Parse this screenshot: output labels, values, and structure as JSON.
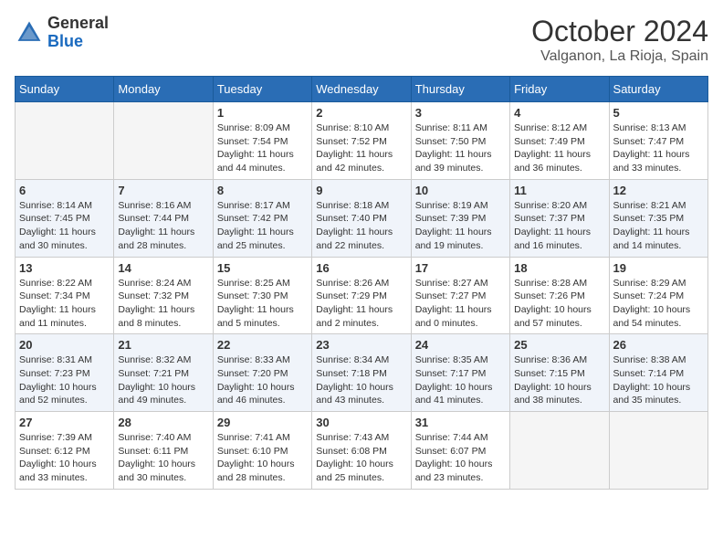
{
  "header": {
    "logo_general": "General",
    "logo_blue": "Blue",
    "month_title": "October 2024",
    "location": "Valganon, La Rioja, Spain"
  },
  "days_of_week": [
    "Sunday",
    "Monday",
    "Tuesday",
    "Wednesday",
    "Thursday",
    "Friday",
    "Saturday"
  ],
  "weeks": [
    [
      {
        "day": "",
        "sunrise": "",
        "sunset": "",
        "daylight": ""
      },
      {
        "day": "",
        "sunrise": "",
        "sunset": "",
        "daylight": ""
      },
      {
        "day": "1",
        "sunrise": "Sunrise: 8:09 AM",
        "sunset": "Sunset: 7:54 PM",
        "daylight": "Daylight: 11 hours and 44 minutes."
      },
      {
        "day": "2",
        "sunrise": "Sunrise: 8:10 AM",
        "sunset": "Sunset: 7:52 PM",
        "daylight": "Daylight: 11 hours and 42 minutes."
      },
      {
        "day": "3",
        "sunrise": "Sunrise: 8:11 AM",
        "sunset": "Sunset: 7:50 PM",
        "daylight": "Daylight: 11 hours and 39 minutes."
      },
      {
        "day": "4",
        "sunrise": "Sunrise: 8:12 AM",
        "sunset": "Sunset: 7:49 PM",
        "daylight": "Daylight: 11 hours and 36 minutes."
      },
      {
        "day": "5",
        "sunrise": "Sunrise: 8:13 AM",
        "sunset": "Sunset: 7:47 PM",
        "daylight": "Daylight: 11 hours and 33 minutes."
      }
    ],
    [
      {
        "day": "6",
        "sunrise": "Sunrise: 8:14 AM",
        "sunset": "Sunset: 7:45 PM",
        "daylight": "Daylight: 11 hours and 30 minutes."
      },
      {
        "day": "7",
        "sunrise": "Sunrise: 8:16 AM",
        "sunset": "Sunset: 7:44 PM",
        "daylight": "Daylight: 11 hours and 28 minutes."
      },
      {
        "day": "8",
        "sunrise": "Sunrise: 8:17 AM",
        "sunset": "Sunset: 7:42 PM",
        "daylight": "Daylight: 11 hours and 25 minutes."
      },
      {
        "day": "9",
        "sunrise": "Sunrise: 8:18 AM",
        "sunset": "Sunset: 7:40 PM",
        "daylight": "Daylight: 11 hours and 22 minutes."
      },
      {
        "day": "10",
        "sunrise": "Sunrise: 8:19 AM",
        "sunset": "Sunset: 7:39 PM",
        "daylight": "Daylight: 11 hours and 19 minutes."
      },
      {
        "day": "11",
        "sunrise": "Sunrise: 8:20 AM",
        "sunset": "Sunset: 7:37 PM",
        "daylight": "Daylight: 11 hours and 16 minutes."
      },
      {
        "day": "12",
        "sunrise": "Sunrise: 8:21 AM",
        "sunset": "Sunset: 7:35 PM",
        "daylight": "Daylight: 11 hours and 14 minutes."
      }
    ],
    [
      {
        "day": "13",
        "sunrise": "Sunrise: 8:22 AM",
        "sunset": "Sunset: 7:34 PM",
        "daylight": "Daylight: 11 hours and 11 minutes."
      },
      {
        "day": "14",
        "sunrise": "Sunrise: 8:24 AM",
        "sunset": "Sunset: 7:32 PM",
        "daylight": "Daylight: 11 hours and 8 minutes."
      },
      {
        "day": "15",
        "sunrise": "Sunrise: 8:25 AM",
        "sunset": "Sunset: 7:30 PM",
        "daylight": "Daylight: 11 hours and 5 minutes."
      },
      {
        "day": "16",
        "sunrise": "Sunrise: 8:26 AM",
        "sunset": "Sunset: 7:29 PM",
        "daylight": "Daylight: 11 hours and 2 minutes."
      },
      {
        "day": "17",
        "sunrise": "Sunrise: 8:27 AM",
        "sunset": "Sunset: 7:27 PM",
        "daylight": "Daylight: 11 hours and 0 minutes."
      },
      {
        "day": "18",
        "sunrise": "Sunrise: 8:28 AM",
        "sunset": "Sunset: 7:26 PM",
        "daylight": "Daylight: 10 hours and 57 minutes."
      },
      {
        "day": "19",
        "sunrise": "Sunrise: 8:29 AM",
        "sunset": "Sunset: 7:24 PM",
        "daylight": "Daylight: 10 hours and 54 minutes."
      }
    ],
    [
      {
        "day": "20",
        "sunrise": "Sunrise: 8:31 AM",
        "sunset": "Sunset: 7:23 PM",
        "daylight": "Daylight: 10 hours and 52 minutes."
      },
      {
        "day": "21",
        "sunrise": "Sunrise: 8:32 AM",
        "sunset": "Sunset: 7:21 PM",
        "daylight": "Daylight: 10 hours and 49 minutes."
      },
      {
        "day": "22",
        "sunrise": "Sunrise: 8:33 AM",
        "sunset": "Sunset: 7:20 PM",
        "daylight": "Daylight: 10 hours and 46 minutes."
      },
      {
        "day": "23",
        "sunrise": "Sunrise: 8:34 AM",
        "sunset": "Sunset: 7:18 PM",
        "daylight": "Daylight: 10 hours and 43 minutes."
      },
      {
        "day": "24",
        "sunrise": "Sunrise: 8:35 AM",
        "sunset": "Sunset: 7:17 PM",
        "daylight": "Daylight: 10 hours and 41 minutes."
      },
      {
        "day": "25",
        "sunrise": "Sunrise: 8:36 AM",
        "sunset": "Sunset: 7:15 PM",
        "daylight": "Daylight: 10 hours and 38 minutes."
      },
      {
        "day": "26",
        "sunrise": "Sunrise: 8:38 AM",
        "sunset": "Sunset: 7:14 PM",
        "daylight": "Daylight: 10 hours and 35 minutes."
      }
    ],
    [
      {
        "day": "27",
        "sunrise": "Sunrise: 7:39 AM",
        "sunset": "Sunset: 6:12 PM",
        "daylight": "Daylight: 10 hours and 33 minutes."
      },
      {
        "day": "28",
        "sunrise": "Sunrise: 7:40 AM",
        "sunset": "Sunset: 6:11 PM",
        "daylight": "Daylight: 10 hours and 30 minutes."
      },
      {
        "day": "29",
        "sunrise": "Sunrise: 7:41 AM",
        "sunset": "Sunset: 6:10 PM",
        "daylight": "Daylight: 10 hours and 28 minutes."
      },
      {
        "day": "30",
        "sunrise": "Sunrise: 7:43 AM",
        "sunset": "Sunset: 6:08 PM",
        "daylight": "Daylight: 10 hours and 25 minutes."
      },
      {
        "day": "31",
        "sunrise": "Sunrise: 7:44 AM",
        "sunset": "Sunset: 6:07 PM",
        "daylight": "Daylight: 10 hours and 23 minutes."
      },
      {
        "day": "",
        "sunrise": "",
        "sunset": "",
        "daylight": ""
      },
      {
        "day": "",
        "sunrise": "",
        "sunset": "",
        "daylight": ""
      }
    ]
  ]
}
